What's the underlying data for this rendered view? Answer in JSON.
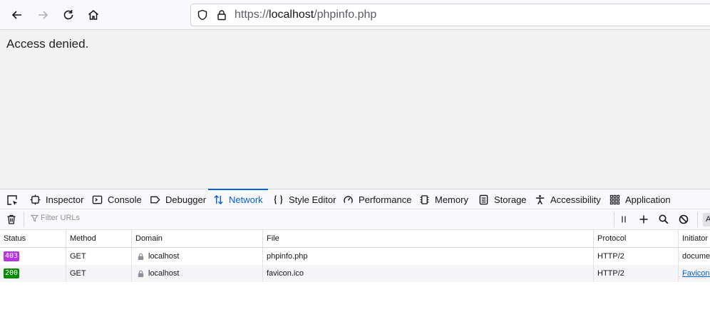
{
  "browser": {
    "url_scheme": "https://",
    "url_host": "localhost",
    "url_path": "/phpinfo.php"
  },
  "page": {
    "message": "Access denied."
  },
  "devtools": {
    "tabs": [
      {
        "label": "Inspector",
        "icon": "inspector-icon"
      },
      {
        "label": "Console",
        "icon": "console-icon"
      },
      {
        "label": "Debugger",
        "icon": "debugger-icon"
      },
      {
        "label": "Network",
        "icon": "network-icon",
        "active": true
      },
      {
        "label": "Style Editor",
        "icon": "braces-icon"
      },
      {
        "label": "Performance",
        "icon": "gauge-icon"
      },
      {
        "label": "Memory",
        "icon": "memory-icon"
      },
      {
        "label": "Storage",
        "icon": "storage-icon"
      },
      {
        "label": "Accessibility",
        "icon": "accessibility-icon"
      },
      {
        "label": "Application",
        "icon": "grid-icon"
      }
    ],
    "filter_placeholder": "Filter URLs",
    "toolbar_button_label": "A",
    "columns": [
      "Status",
      "Method",
      "Domain",
      "File",
      "Protocol",
      "Initiator"
    ],
    "rows": [
      {
        "status": "403",
        "status_color": "#b833e1",
        "method": "GET",
        "domain": "localhost",
        "file": "phpinfo.php",
        "protocol": "HTTP/2",
        "initiator": "docume"
      },
      {
        "status": "200",
        "status_color": "#058b00",
        "method": "GET",
        "domain": "localhost",
        "file": "favicon.ico",
        "protocol": "HTTP/2",
        "initiator": "FaviconL"
      }
    ]
  },
  "colors": {
    "accent": "#0060df"
  }
}
